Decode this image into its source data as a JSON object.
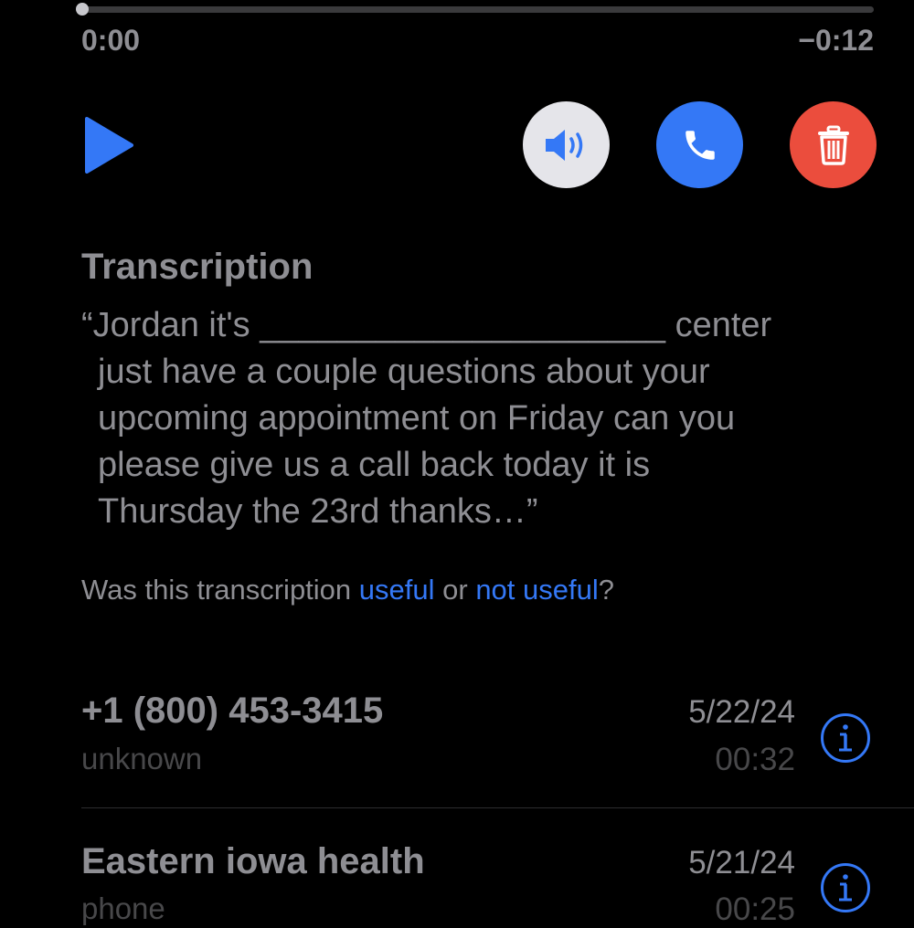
{
  "player": {
    "elapsed": "0:00",
    "remaining": "−0:12",
    "progress": 0.0
  },
  "controls": {
    "play_icon": "play-icon",
    "speaker_icon": "speaker-icon",
    "call_icon": "phone-icon",
    "delete_icon": "trash-icon"
  },
  "transcription": {
    "heading": "Transcription",
    "lines": [
      "“Jordan it's _____________________ center",
      "just have a couple questions about your",
      "upcoming appointment on Friday can you",
      "please give us a call back today it is",
      "Thursday the 23rd thanks…”"
    ]
  },
  "feedback": {
    "prefix": "Was this transcription ",
    "useful": "useful",
    "middle": " or ",
    "not_useful": "not useful",
    "suffix": "?"
  },
  "voicemails": [
    {
      "name": "+1 (800) 453-3415",
      "label": "unknown",
      "date": "5/22/24",
      "duration": "00:32"
    },
    {
      "name": "Eastern iowa health",
      "label": "phone",
      "date": "5/21/24",
      "duration": "00:25"
    }
  ],
  "colors": {
    "accent": "#3478f6",
    "delete": "#eb4d3d",
    "speaker_bg": "#e5e5ea"
  }
}
